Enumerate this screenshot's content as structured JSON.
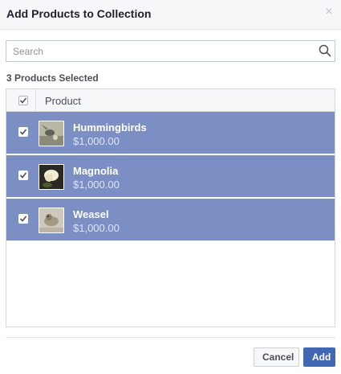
{
  "dialog": {
    "title": "Add Products to Collection",
    "close_icon": "close-icon"
  },
  "search": {
    "placeholder": "Search",
    "value": "",
    "icon": "search-icon"
  },
  "selection": {
    "count_text": "3 Products Selected"
  },
  "table": {
    "header_checked": true,
    "column_header": "Product",
    "rows": [
      {
        "name": "Hummingbirds",
        "price": "$1,000.00",
        "checked": true,
        "thumbnail": "hummingbird-image"
      },
      {
        "name": "Magnolia",
        "price": "$1,000.00",
        "checked": true,
        "thumbnail": "magnolia-image"
      },
      {
        "name": "Weasel",
        "price": "$1,000.00",
        "checked": true,
        "thumbnail": "weasel-image"
      }
    ]
  },
  "footer": {
    "cancel_label": "Cancel",
    "add_label": "Add"
  },
  "colors": {
    "selected_row": "#7b8fc4",
    "primary_button": "#4267b2"
  }
}
